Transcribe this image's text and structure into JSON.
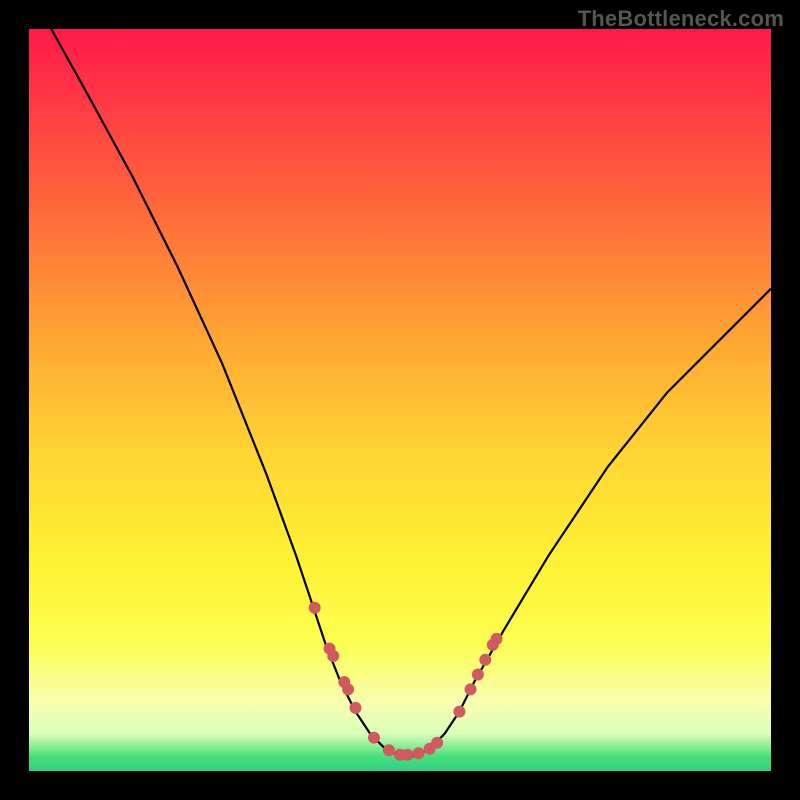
{
  "watermark": "TheBottleneck.com",
  "chart_data": {
    "type": "line",
    "title": "",
    "xlabel": "",
    "ylabel": "",
    "xlim": [
      0,
      100
    ],
    "ylim": [
      0,
      100
    ],
    "series": [
      {
        "name": "curve",
        "x": [
          3,
          8,
          14,
          20,
          26,
          32,
          36,
          38,
          40,
          42,
          44,
          46,
          48,
          50,
          52,
          54,
          56,
          58,
          60,
          64,
          70,
          78,
          86,
          94,
          100
        ],
        "y": [
          100,
          91,
          80,
          68,
          55,
          40,
          29,
          23,
          17,
          12,
          8,
          5,
          3,
          2,
          2,
          3,
          5,
          8,
          12,
          19,
          29,
          41,
          51,
          59,
          65
        ]
      }
    ],
    "markers": {
      "name": "highlight-points",
      "color": "#d15a60",
      "x": [
        38.5,
        40.5,
        41.0,
        42.5,
        43.0,
        44.0,
        46.5,
        48.5,
        50.0,
        51.0,
        52.5,
        54.0,
        55.0,
        58.0,
        59.5,
        60.5,
        61.5,
        62.5,
        63.0
      ],
      "y": [
        22.0,
        16.5,
        15.5,
        12.0,
        11.0,
        8.5,
        4.5,
        2.8,
        2.2,
        2.2,
        2.4,
        3.0,
        3.8,
        8.0,
        11.0,
        13.0,
        15.0,
        17.0,
        17.8
      ]
    }
  }
}
